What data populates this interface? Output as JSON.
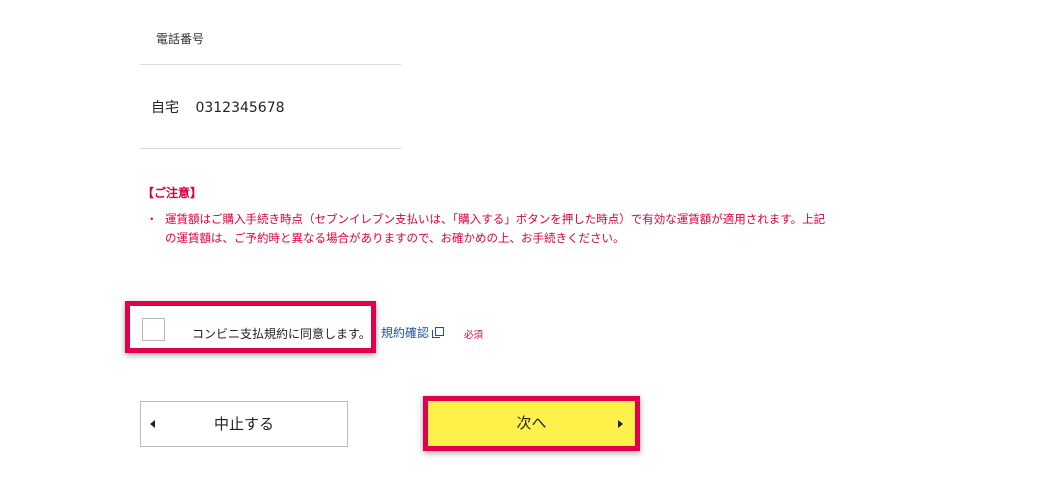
{
  "phone_section": {
    "label": "電話番号",
    "type": "自宅",
    "number": "0312345678"
  },
  "notice": {
    "title": "【ご注意】",
    "bullet": "・",
    "items": [
      "運賃額はご購入手続き時点（セブンイレブン支払いは、「購入する」ボタンを押した時点）で有効な運賃額が適用されます。上記の運賃額は、ご予約時と異なる場合がありますので、お確かめの上、お手続きください。"
    ]
  },
  "agreement": {
    "checked": false,
    "label": "コンビニ支払規約に同意します。",
    "terms_link": "規約確認",
    "required": "必須"
  },
  "buttons": {
    "cancel": "中止する",
    "next": "次へ"
  },
  "icons": {
    "external_link": "external-window-icon",
    "prev_arrow": "triangle-left-icon",
    "next_arrow": "triangle-right-icon"
  },
  "colors": {
    "alert_red": "#e0003c",
    "highlight_border": "#e0004d",
    "next_button_bg": "#fff14a",
    "link_blue": "#1f4e9c"
  }
}
